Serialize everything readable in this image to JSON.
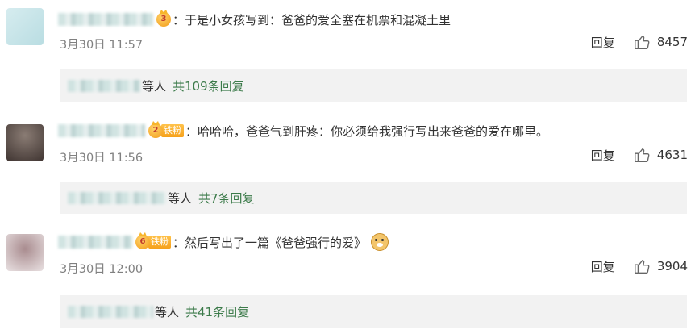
{
  "comments": [
    {
      "rank_badge": "3",
      "fan_badge": "",
      "text": "于是小女孩写到：爸爸的爱全塞在机票和混凝土里",
      "time": "3月30日 11:57",
      "reply_label": "回复",
      "likes": "8457",
      "replies_prefix": "等人",
      "replies_count": "共109条回复"
    },
    {
      "rank_badge": "2",
      "fan_badge": "铁粉",
      "text": "哈哈哈，爸爸气到肝疼：你必须给我强行写出来爸爸的爱在哪里。",
      "time": "3月30日 11:56",
      "reply_label": "回复",
      "likes": "4631",
      "replies_prefix": "等人",
      "replies_count": "共7条回复"
    },
    {
      "rank_badge": "6",
      "fan_badge": "铁粉",
      "text": "然后写出了一篇《爸爸强行的爱》",
      "time": "3月30日 12:00",
      "reply_label": "回复",
      "likes": "3904",
      "replies_prefix": "等人",
      "replies_count": "共41条回复"
    }
  ],
  "colors": {
    "link": "#3c7b4a",
    "meta": "#808080",
    "reply_bg": "#f2f2f2"
  },
  "icons": {
    "like": "thumbs-up-icon",
    "emoji": "doge-emoji-icon"
  }
}
